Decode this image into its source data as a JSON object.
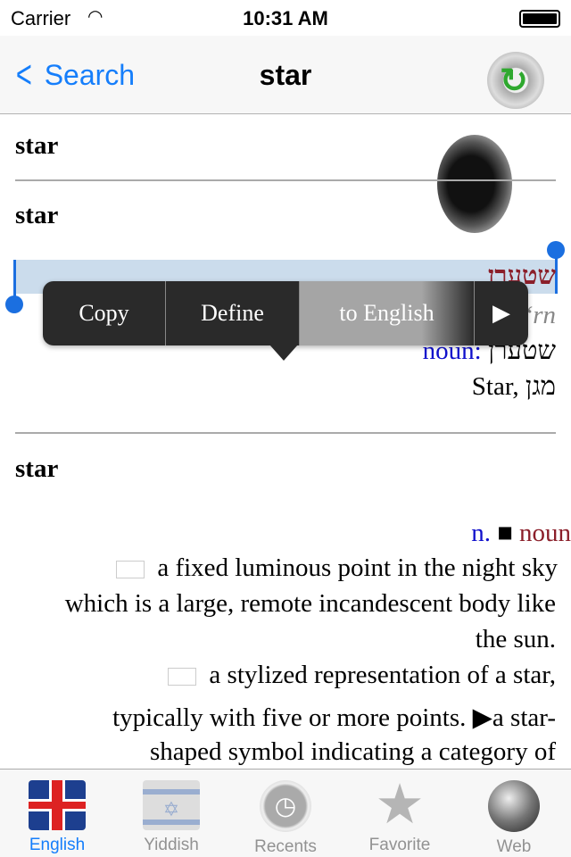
{
  "status": {
    "carrier": "Carrier",
    "time": "10:31 AM",
    "wifi_icon": "wifi-icon",
    "battery_level": 1.0
  },
  "nav": {
    "back_label": "Search",
    "title": "star",
    "refresh_icon": "gear-refresh-icon"
  },
  "entry1": {
    "headword": "star"
  },
  "entry2": {
    "headword": "star",
    "yiddish": "שטערן",
    "transliteration": "Ştʻrn",
    "pos_label": "noun:",
    "pos_word": "שטערן",
    "gloss": "Star, מגן"
  },
  "entry3": {
    "headword": "star",
    "pos_abbr": "n.",
    "pos_mark": "■",
    "pos_full": "noun",
    "lines": [
      "a fixed luminous point in the night sky",
      "which is a large, remote incandescent body like",
      "the sun.",
      "a stylized representation of a star,",
      "typically with five or more points.",
      "a star-",
      "shaped symbol indicating a category of"
    ]
  },
  "menu": {
    "items": [
      "Copy",
      "Define",
      "to English"
    ],
    "more": "▶"
  },
  "tabs": [
    {
      "label": "English",
      "active": true
    },
    {
      "label": "Yiddish"
    },
    {
      "label": "Recents"
    },
    {
      "label": "Favorite"
    },
    {
      "label": "Web"
    }
  ],
  "colors": {
    "accent": "#157efb",
    "yiddish": "#8b1f2a",
    "pos": "#1010cc",
    "selection": "#cbdcec"
  }
}
